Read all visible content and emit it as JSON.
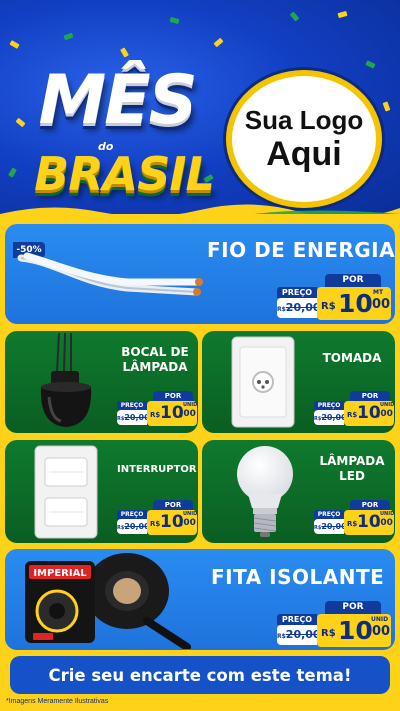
{
  "header": {
    "title_line1": "MÊS",
    "title_small": "do",
    "title_line2": "BRASIL",
    "logo_line1": "Sua Logo",
    "logo_line2": "Aqui"
  },
  "colors": {
    "blue": "#1e73dc",
    "green": "#0f7a2e",
    "yellow": "#ffd21a",
    "navy": "#0f3c9c"
  },
  "products": [
    {
      "name": "FIO DE ENERGIA",
      "discount": "-50%",
      "icon": "electric-wire",
      "old_label": "PREÇO",
      "old_currency": "R$",
      "old_price": "20,00",
      "por_label": "POR",
      "currency": "R$",
      "price_int": "10",
      "price_dec": ",00",
      "unit": "MT"
    },
    {
      "name": "BOCAL DE LÂMPADA",
      "icon": "lamp-socket",
      "old_label": "PREÇO",
      "old_currency": "R$",
      "old_price": "20,00",
      "por_label": "POR",
      "currency": "R$",
      "price_int": "10",
      "price_dec": ",00",
      "unit": "UNID"
    },
    {
      "name": "TOMADA",
      "icon": "power-outlet",
      "old_label": "PREÇO",
      "old_currency": "R$",
      "old_price": "20,00",
      "por_label": "POR",
      "currency": "R$",
      "price_int": "10",
      "price_dec": ",00",
      "unit": "UNID"
    },
    {
      "name": "INTERRUPTOR",
      "icon": "light-switch",
      "old_label": "PREÇO",
      "old_currency": "R$",
      "old_price": "20,00",
      "por_label": "POR",
      "currency": "R$",
      "price_int": "10",
      "price_dec": ",00",
      "unit": "UNID"
    },
    {
      "name": "LÂMPADA LED",
      "icon": "led-bulb",
      "old_label": "PREÇO",
      "old_currency": "R$",
      "old_price": "20,00",
      "por_label": "POR",
      "currency": "R$",
      "price_int": "10",
      "price_dec": ",00",
      "unit": "UNID"
    },
    {
      "name": "FITA ISOLANTE",
      "icon": "insulating-tape",
      "brand": "IMPERIAL",
      "old_label": "PREÇO",
      "old_currency": "R$",
      "old_price": "20,00",
      "por_label": "POR",
      "currency": "R$",
      "price_int": "10",
      "price_dec": ",00",
      "unit": "UNID"
    }
  ],
  "footer": {
    "cta": "Crie seu encarte com este tema!",
    "disclaimer": "*Imagens Meramente Ilustrativas"
  }
}
